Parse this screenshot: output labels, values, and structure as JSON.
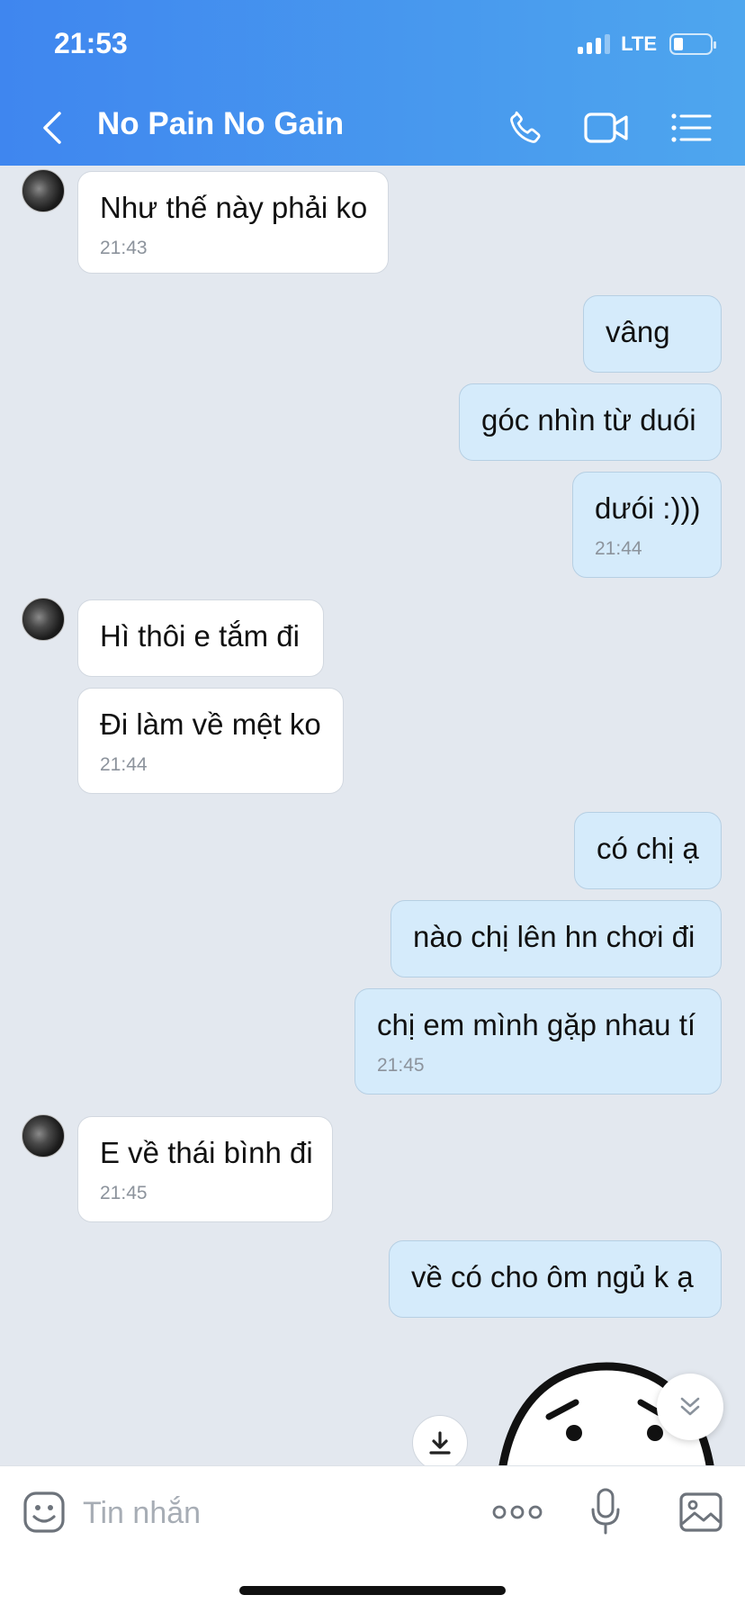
{
  "status_bar": {
    "time": "21:53",
    "network": "LTE"
  },
  "header": {
    "title": "No Pain No Gain",
    "icons": [
      "back-chevron-icon",
      "phone-icon",
      "video-camera-icon",
      "menu-list-icon"
    ],
    "gradient": [
      "#3f86ef",
      "#4ea6ee"
    ]
  },
  "messages": [
    {
      "dir": "in",
      "text": "Như thế này phải ko",
      "time": "21:43"
    },
    {
      "dir": "out",
      "text": "vâng"
    },
    {
      "dir": "out",
      "text": "góc nhìn từ duói"
    },
    {
      "dir": "out",
      "text": "dưói :)))",
      "time": "21:44"
    },
    {
      "dir": "in",
      "text": "Hì thôi e tắm đi"
    },
    {
      "dir": "in",
      "text": "Đi làm về mệt ko",
      "time": "21:44"
    },
    {
      "dir": "out",
      "text": "có chị ạ"
    },
    {
      "dir": "out",
      "text": "nào chị lên hn chơi đi"
    },
    {
      "dir": "out",
      "text": "chị em mình gặp nhau tí",
      "time": "21:45"
    },
    {
      "dir": "in",
      "text": "E về thái bình đi",
      "time": "21:45"
    },
    {
      "dir": "out",
      "text": "về có cho ôm ngủ k ạ"
    }
  ],
  "input_bar": {
    "placeholder": "Tin nhắn",
    "icons": [
      "sticker-icon",
      "more-options-icon",
      "microphone-icon",
      "image-gallery-icon"
    ]
  },
  "colors": {
    "chat_background": "#e3e8ef",
    "incoming_bubble": "#ffffff",
    "outgoing_bubble": "#d5ebfb",
    "timestamp": "#8c939c"
  }
}
